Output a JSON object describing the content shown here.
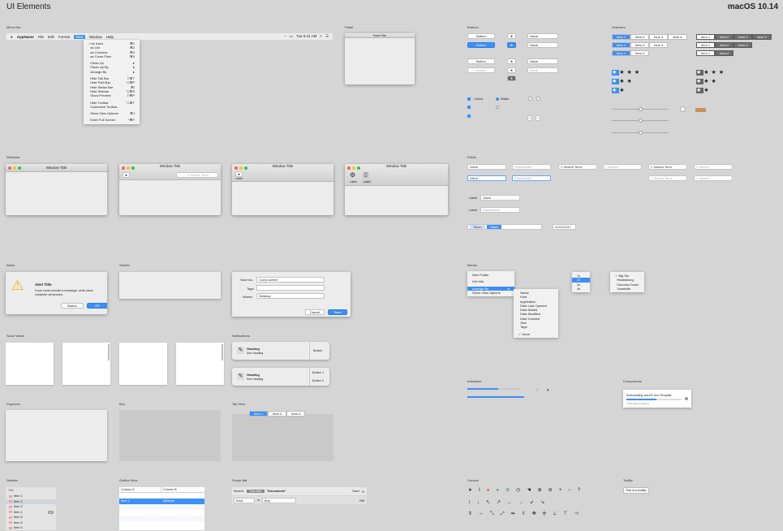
{
  "header": {
    "title": "UI Elements",
    "version": "macOS 10.14"
  },
  "sections": {
    "menu_bar": "Menu Bar",
    "panel": "Panel",
    "buttons": "Buttons",
    "selectors": "Selectors",
    "windows": "Windows",
    "fields": "Fields",
    "alerts": "Alerts",
    "sheets": "Sheets",
    "menus": "Menus",
    "scroll_views": "Scroll Views",
    "notifications": "Notifications",
    "indicators": "Indicators",
    "components": "Components",
    "popovers": "Popovers",
    "box": "Box",
    "tab_view": "Tab View",
    "sidebar": "Sidebar",
    "outline_view": "Outline View",
    "scope_bar": "Scope Bar",
    "cursors": "Cursors",
    "tooltip": "Tooltip"
  },
  "menubar": {
    "app": "AppName",
    "items": [
      "File",
      "Edit",
      "Format",
      "View",
      "Window",
      "Help"
    ],
    "clock": "Tue 9:41 AM"
  },
  "view_menu": [
    {
      "label": "as Icons",
      "key": "⌘1",
      "check": true
    },
    {
      "label": "as List",
      "key": "⌘2"
    },
    {
      "label": "as Columns",
      "key": "⌘3"
    },
    {
      "label": "as Cover Flow",
      "key": "⌘4"
    },
    {
      "sep": true
    },
    {
      "label": "Clean Up",
      "key": "▸"
    },
    {
      "label": "Clean Up By",
      "key": "▸"
    },
    {
      "label": "Arrange By",
      "key": "▸"
    },
    {
      "sep": true
    },
    {
      "label": "Hide Tab Bar",
      "key": "⇧⌘T"
    },
    {
      "label": "Hide Path Bar",
      "key": "⌥⌘P"
    },
    {
      "label": "Hide Status Bar",
      "key": "⌘/"
    },
    {
      "label": "Hide Sidebar",
      "key": "⌥⌘S"
    },
    {
      "label": "Show Preview",
      "key": "⇧⌘P"
    },
    {
      "sep": true
    },
    {
      "label": "Hide Toolbar",
      "key": "⌥⌘T"
    },
    {
      "label": "Customize Toolbar...",
      "key": ""
    },
    {
      "sep": true
    },
    {
      "label": "Show View Options",
      "key": "⌘J"
    },
    {
      "sep": true
    },
    {
      "label": "Enter Full Screen",
      "key": "^⌘F"
    }
  ],
  "panel": {
    "title": "Panel Title"
  },
  "buttons": {
    "button": "Button",
    "value": "Value"
  },
  "selectors": {
    "items": [
      "Item 1",
      "Item 2",
      "Item 3",
      "Item 4"
    ]
  },
  "windows": {
    "title": "Window Title",
    "search": "Search Term",
    "label": "Label"
  },
  "fields": {
    "value": "Value",
    "placeholder": "Placeholder",
    "search": "Search Term",
    "search_ph": "Search",
    "label": "Label",
    "token": "Token",
    "date": "01/01/2017"
  },
  "alert": {
    "title": "Alert Title",
    "message": "If you must provide a message, write short, complete sentences.",
    "button": "Button",
    "ok": "OK"
  },
  "save_sheet": {
    "save_as_label": "Save As:",
    "save_as": "Comp.sketch",
    "tags_label": "Tags:",
    "where_label": "Where:",
    "where": "Desktop",
    "cancel": "Cancel",
    "save": "Save"
  },
  "menus": {
    "context": [
      "New Folder",
      "Get Info",
      "Arrange By",
      "Show View Options"
    ],
    "sub": [
      "Name",
      "Kind",
      "Application",
      "Date Last Opened",
      "Date Added",
      "Date Modified",
      "Date Created",
      "Size",
      "Tags",
      "None"
    ],
    "pop": [
      "1x",
      "2x",
      "3x",
      "4x"
    ],
    "places": [
      "Big Sur",
      "Healdsburg",
      "Sonoma Coast",
      "Yountville"
    ]
  },
  "notifications": {
    "heading": "Heading",
    "sub": "Sub Heading",
    "button": "Button",
    "button1": "Button 1",
    "button2": "Button 2"
  },
  "components": {
    "download": "Downloading macOS Icon Template",
    "remaining": "2 seconds remaining"
  },
  "tabs": [
    "Item 1",
    "Item 2",
    "Item 3"
  ],
  "sidebar": {
    "title": "Title",
    "items": [
      "Item 1",
      "Item 2",
      "Item 3",
      "Item 4",
      "Item 5",
      "Item 6",
      "Item 3"
    ],
    "badge": "42"
  },
  "outline": {
    "col_a": "Column A",
    "col_b": "Column B",
    "row_item": "Item 2",
    "row_attr": "Attribute"
  },
  "scope": {
    "search": "Search:",
    "this_mac": "This Mac",
    "docs": "\"Documents\"",
    "save": "Save",
    "kind": "Kind",
    "is": "is",
    "any": "Any"
  },
  "tooltip": "This is a tooltip."
}
